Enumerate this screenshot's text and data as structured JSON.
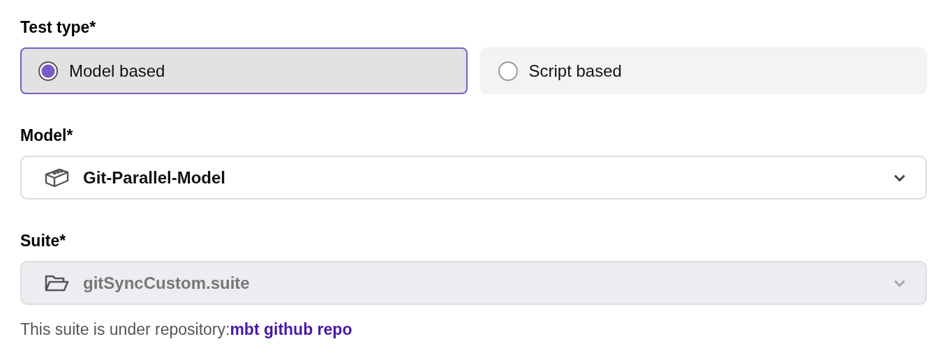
{
  "test_type": {
    "label": "Test type*",
    "options": [
      {
        "label": "Model based",
        "selected": true
      },
      {
        "label": "Script based",
        "selected": false
      }
    ]
  },
  "model": {
    "label": "Model*",
    "value": "Git-Parallel-Model",
    "disabled": false
  },
  "suite": {
    "label": "Suite*",
    "value": "gitSyncCustom.suite",
    "disabled": true
  },
  "helper": {
    "text": "This suite is under repository:",
    "link": "mbt github repo"
  }
}
